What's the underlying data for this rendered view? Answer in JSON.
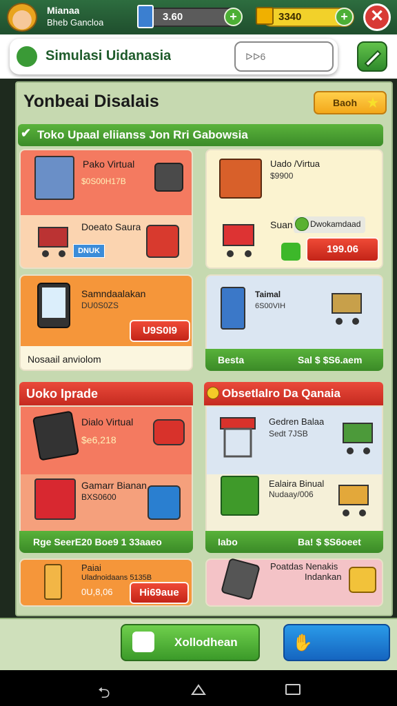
{
  "player": {
    "name": "Mianaa",
    "club": "Bheb Gancloa"
  },
  "currency": {
    "gems": "3.60",
    "gold": "3340"
  },
  "header": {
    "app_title": "Simulasi Uidanasia",
    "search_value": "ᐅᐅ6"
  },
  "main": {
    "title": "Yonbeai Disalais",
    "top_button_label": "Baoh"
  },
  "section1": {
    "title": "Toko Upaal eliianss  Jon Rri Gabowsia",
    "card1": {
      "item1_name": "Pako Virtual",
      "item1_value": "$0S00H17B",
      "item2_name": "Doeato Saura",
      "item2_tag": "DNUK"
    },
    "card2": {
      "item1_name": "Uado /Virtua",
      "item1_value": "$9900",
      "item2_name": "Suan",
      "item2_tag": "Dwokamdaad",
      "price": "199.06"
    },
    "card3": {
      "item_name": "Samndaalakan",
      "item_value": "DU0S0ZS",
      "price": "U9S0I9",
      "footer": "Nosaail anviolom"
    },
    "card4": {
      "item_name": "Taimal",
      "item_value": "6S00VIH",
      "strip_left": "Besta",
      "strip_right": "Sal $ $S6.aem"
    }
  },
  "section2": {
    "left_title": "Uoko Iprade",
    "right_title": "Obsetlalro  Da Qanaia",
    "card5": {
      "item1_name": "Dialo Virtual",
      "item1_value": "$e6,218",
      "item2_name": "Gamarr Bianan",
      "item2_value": "BXS0600",
      "strip": "Rge SeerE20  Boe9 1 33aaeo"
    },
    "card6": {
      "item1_name": "Gedren Balaa",
      "item1_value": "Sedt 7JSB",
      "item2_name": "Ealaira Binual",
      "item2_value": "Nudaay/006",
      "strip_left": "Iabo",
      "strip_right": "Ba! $ $S6oeet"
    },
    "card7": {
      "item_name": "Paiai",
      "item_value1": "Uladnoidaans 5135B",
      "item_value2": "0U,8,06",
      "price": "Hi69aue"
    },
    "card8": {
      "item_name": "Poatdas Nenakis",
      "item_value": "Indankan"
    }
  },
  "bottom": {
    "left_button_label": "Xollodhean"
  },
  "colors": {
    "green": "#3b8b28",
    "red": "#c52a20",
    "orange": "#f5963a",
    "cream": "#fbf6df"
  },
  "icons": [
    "avatar-icon",
    "gem-icon",
    "gold-icon",
    "plus-icon",
    "close-icon",
    "leaf-icon",
    "edit-icon",
    "star-icon",
    "cart-icon",
    "back-icon",
    "home-icon",
    "recents-icon"
  ]
}
